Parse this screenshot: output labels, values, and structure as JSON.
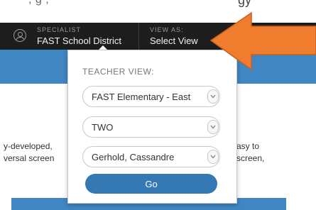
{
  "background": {
    "top_text_left": ", g                    ,",
    "top_text_right": "gy",
    "body_left_lines": [
      "y-developed,",
      "versal screen"
    ],
    "body_right_lines": [
      "asy to",
      "screen,"
    ]
  },
  "header": {
    "role_label": "SPECIALIST",
    "org_name": "FAST School District",
    "viewas_label": "VIEW AS:",
    "viewas_value": "Select View"
  },
  "panel": {
    "title": "TEACHER VIEW:",
    "school_select": "FAST Elementary - East",
    "grade_select": "TWO",
    "teacher_select": "Gerhold, Cassandre",
    "go_label": "Go"
  },
  "colors": {
    "header_bg": "#1d1d1d",
    "banner_blue": "#3f86c3",
    "go_button": "#3478b4",
    "arrow_orange": "#f07c2e"
  },
  "icons": {
    "avatar": "user-avatar-icon",
    "chevron": "chevron-down-icon",
    "arrow": "orange-callout-arrow"
  }
}
